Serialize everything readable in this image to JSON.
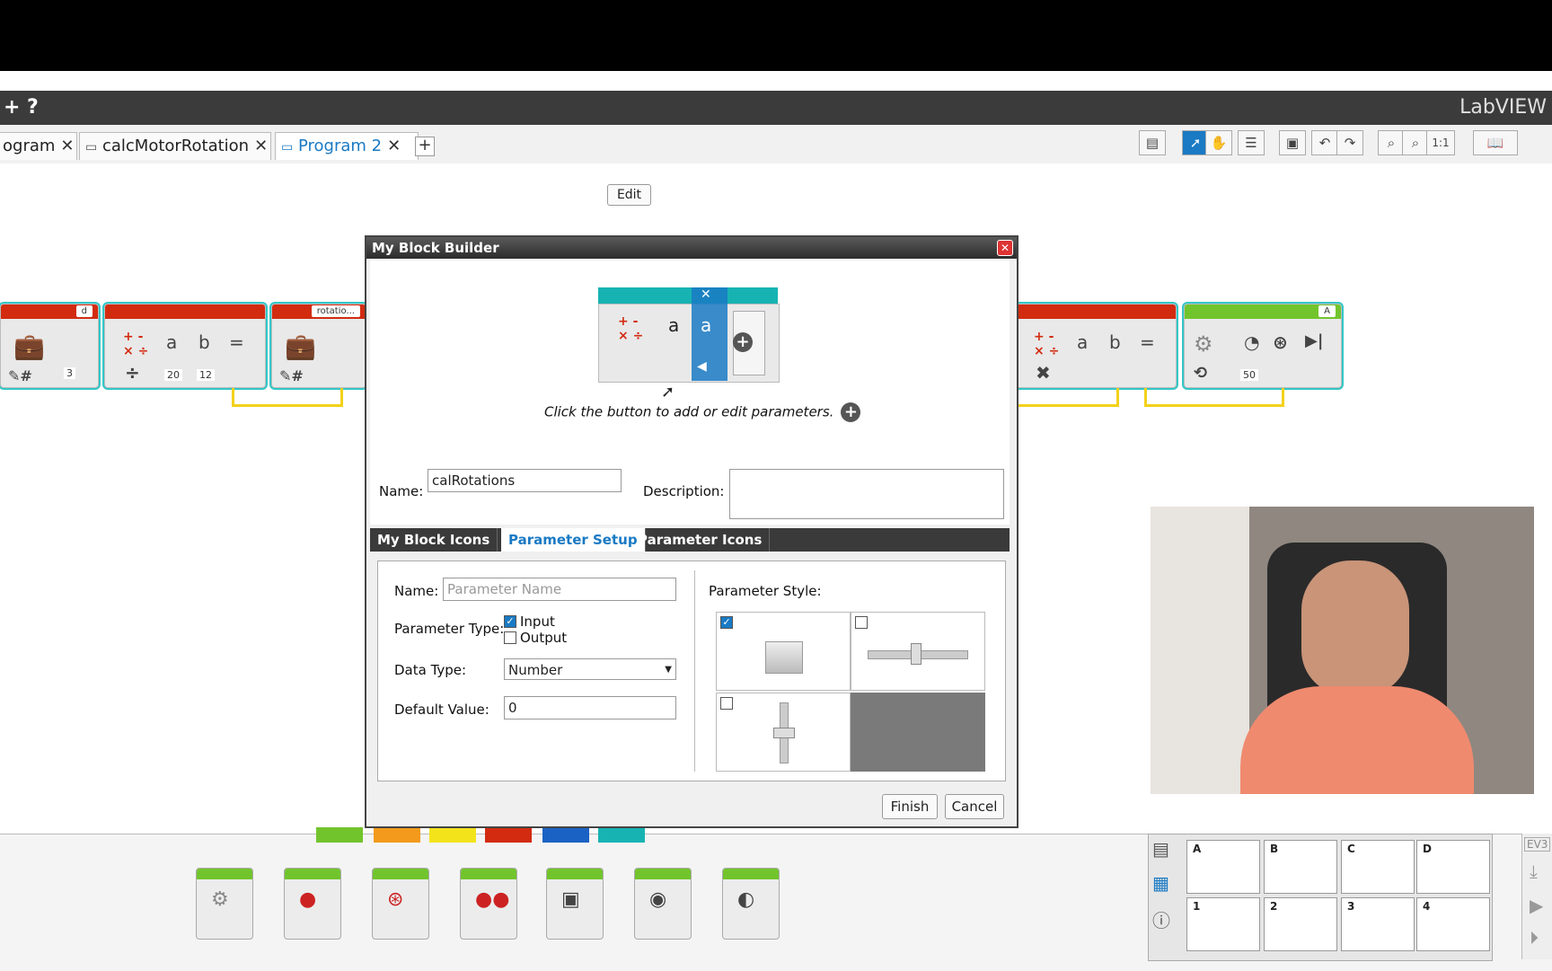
{
  "app": {
    "brand": "LabVIEW",
    "help": "?",
    "add": "+"
  },
  "tabs": [
    {
      "label": "ogram",
      "close": "✕"
    },
    {
      "label": "calcMotorRotation",
      "close": "✕"
    },
    {
      "label": "Program 2",
      "close": "✕"
    }
  ],
  "tab_add": "+",
  "toolbar": {
    "zoom_ratio": "1:1"
  },
  "canvas": {
    "edit_label": "Edit",
    "blocks": {
      "var_d_label": "d",
      "var_d_value": "3",
      "math1_a": "a",
      "math1_b": "b",
      "math1_eq": "=",
      "math1_a_val": "20",
      "math1_b_val": "12",
      "var_rot_label": "rotatio...",
      "math2_a": "a",
      "math2_b": "b",
      "math2_eq": "=",
      "motor_port": "A",
      "motor_val": "50"
    }
  },
  "dialog": {
    "title": "My Block Builder",
    "close": "✕",
    "preview": {
      "param_a1": "a",
      "param_a2": "a"
    },
    "hint": "Click the button to add or edit parameters.",
    "name_label": "Name:",
    "name_value": "calRotations",
    "description_label": "Description:",
    "description_value": "",
    "tabs": [
      "My Block Icons",
      "Parameter Setup",
      "Parameter Icons"
    ],
    "param": {
      "name_label": "Name:",
      "name_placeholder": "Parameter Name",
      "type_label": "Parameter Type:",
      "type_input": "Input",
      "type_output": "Output",
      "data_type_label": "Data Type:",
      "data_type_value": "Number",
      "default_label": "Default Value:",
      "default_value": "0",
      "style_label": "Parameter Style:"
    },
    "finish": "Finish",
    "cancel": "Cancel"
  },
  "hardware": {
    "ports_top": [
      "A",
      "B",
      "C",
      "D"
    ],
    "ports_bottom": [
      "1",
      "2",
      "3",
      "4"
    ],
    "brick": "EV3"
  },
  "colors": {
    "accent": "#1a7ac4",
    "action_block": "#72c42d",
    "data_block": "#d22b10",
    "wire": "#f3d11b",
    "selection": "#33c7c7"
  }
}
